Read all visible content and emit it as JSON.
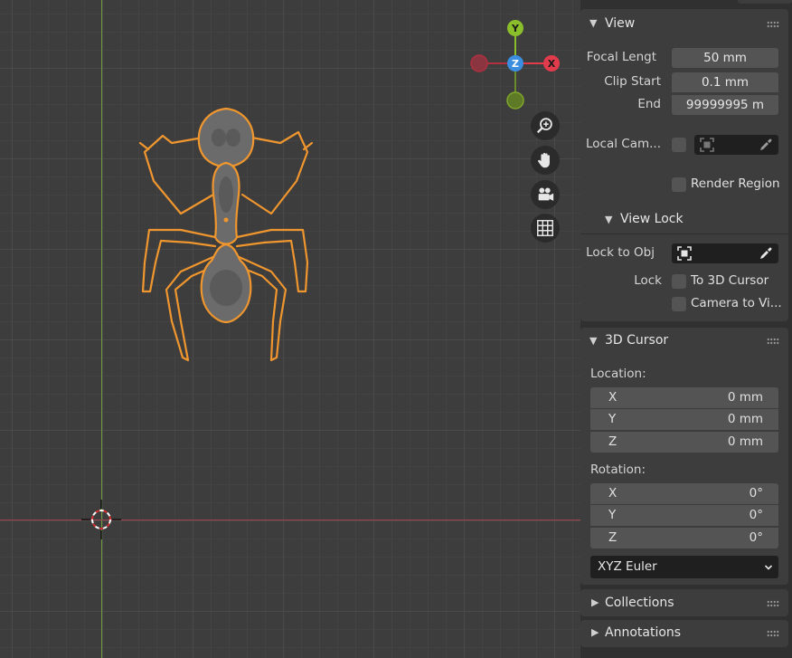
{
  "viewport": {
    "gizmo": {
      "y": "Y",
      "z": "Z",
      "x": "X"
    },
    "tools": [
      {
        "icon": "zoom-icon"
      },
      {
        "icon": "pan-hand-icon"
      },
      {
        "icon": "camera-icon"
      },
      {
        "icon": "ortho-grid-icon"
      }
    ]
  },
  "colors": {
    "selection": "#f0962e",
    "axis_x": "#a0404a",
    "axis_y": "#6f9a3a",
    "gizmo_x": "#e23b4b",
    "gizmo_y": "#8bbe2b",
    "gizmo_z": "#3b8de0"
  },
  "view": {
    "title": "View",
    "focal_label": "Focal Lengt",
    "focal_value": "50 mm",
    "clip_start_label": "Clip Start",
    "clip_start_value": "0.1 mm",
    "clip_end_label": "End",
    "clip_end_value": "99999995 m",
    "local_camera_label": "Local Cam...",
    "render_region_label": "Render Region"
  },
  "view_lock": {
    "title": "View Lock",
    "lock_to_obj_label": "Lock to Obj",
    "lock_label": "Lock",
    "to_3d_cursor_label": "To 3D Cursor",
    "camera_to_view_label": "Camera to Vi..."
  },
  "cursor": {
    "title": "3D Cursor",
    "location_label": "Location:",
    "location": [
      {
        "axis": "X",
        "value": "0 mm"
      },
      {
        "axis": "Y",
        "value": "0 mm"
      },
      {
        "axis": "Z",
        "value": "0 mm"
      }
    ],
    "rotation_label": "Rotation:",
    "rotation": [
      {
        "axis": "X",
        "value": "0°"
      },
      {
        "axis": "Y",
        "value": "0°"
      },
      {
        "axis": "Z",
        "value": "0°"
      }
    ],
    "rotation_mode": "XYZ Euler"
  },
  "collections": {
    "title": "Collections"
  },
  "annotations": {
    "title": "Annotations"
  }
}
